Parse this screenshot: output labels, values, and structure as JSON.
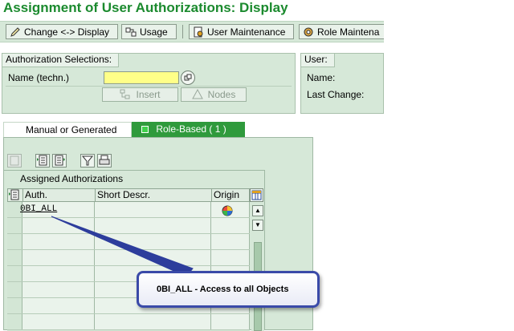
{
  "title": "Assignment of User Authorizations: Display",
  "toolbar": {
    "change_display": "Change <-> Display",
    "usage": "Usage",
    "user_maintenance": "User Maintenance",
    "role_maintenance": "Role Maintena"
  },
  "selections": {
    "group_title": "Authorization Selections:",
    "name_label": "Name (techn.)",
    "name_value": "",
    "insert_label": "Insert",
    "nodes_label": "Nodes"
  },
  "user": {
    "group_title": "User:",
    "name_label": "Name:",
    "last_change_label": "Last Change:"
  },
  "tabs": {
    "manual": "Manual or Generated",
    "role": "Role-Based ( 1 )"
  },
  "table": {
    "title": "Assigned Authorizations",
    "columns": [
      "Auth.",
      "Short Descr.",
      "Origin"
    ],
    "rows": [
      {
        "auth": "0BI_ALL",
        "short_descr": "",
        "origin": "role-icon"
      }
    ]
  },
  "callout": {
    "text": "0BI_ALL - Access to all Objects"
  },
  "colors": {
    "title_green": "#1b8a2e",
    "panel_green": "#d6e8d8",
    "active_tab": "#2f9a3c",
    "input_yellow": "#ffff88",
    "callout_border": "#3a4aa8"
  }
}
